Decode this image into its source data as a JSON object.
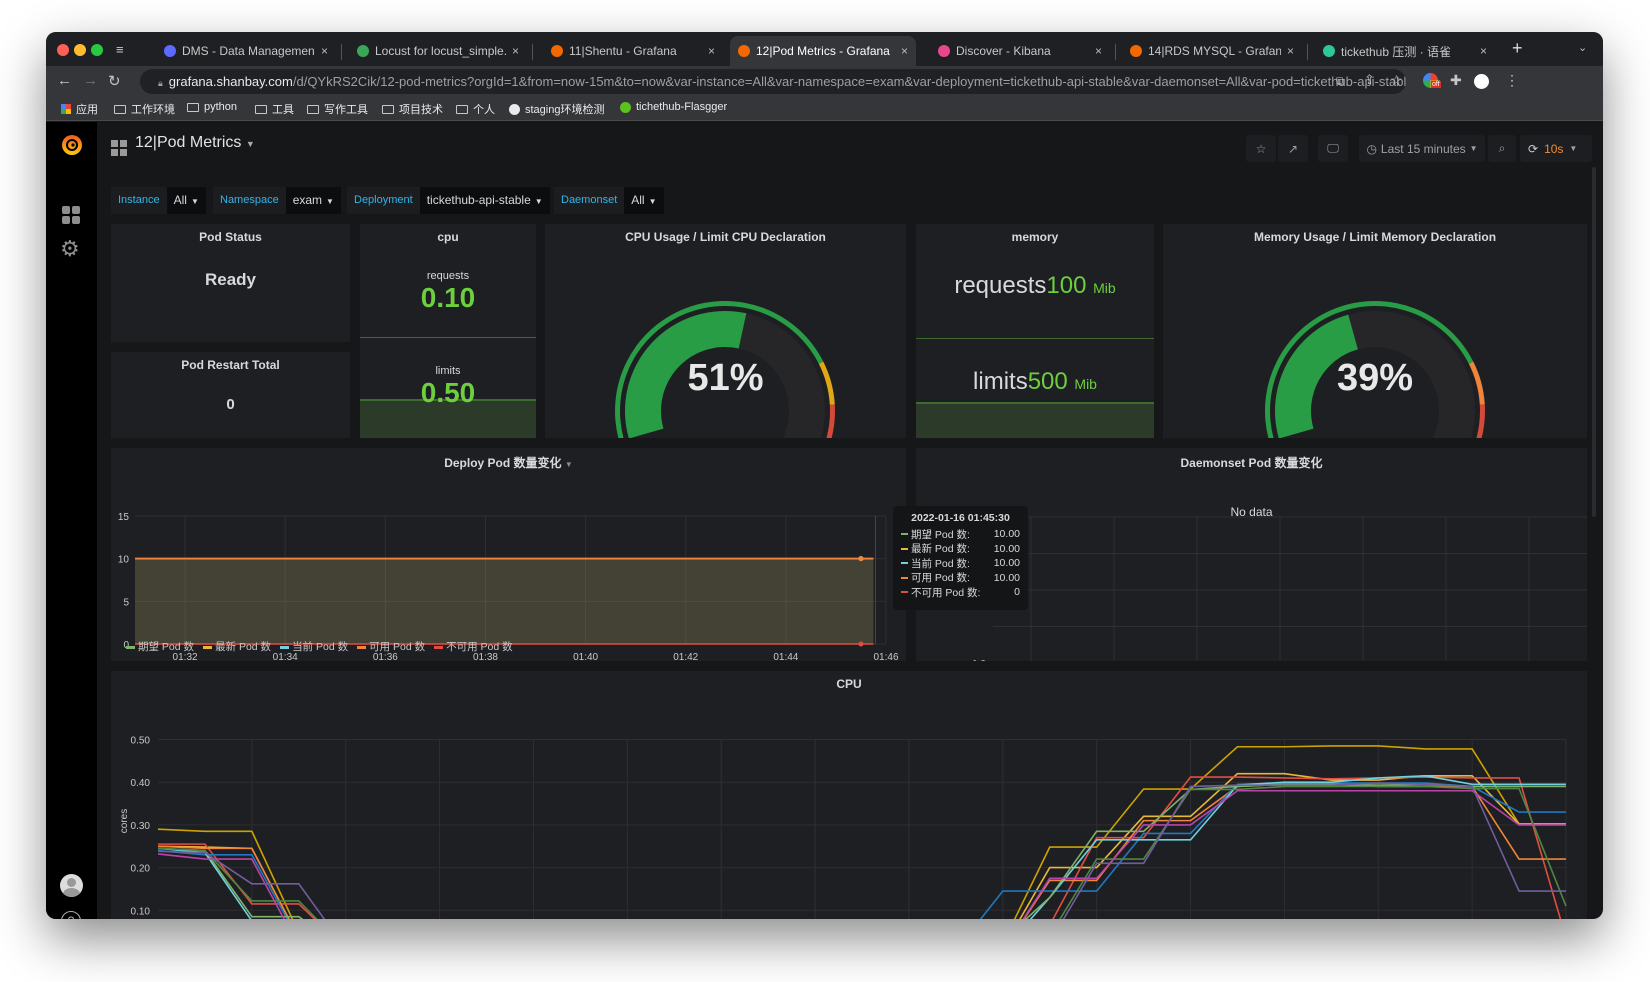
{
  "browser": {
    "tabs": [
      {
        "title": "DMS - Data Management Ser",
        "icon": "dms-icon",
        "color": "#5b6bff"
      },
      {
        "title": "Locust for locust_simple.py",
        "icon": "locust-icon",
        "color": "#3aa757"
      },
      {
        "title": "11|Shentu - Grafana",
        "icon": "grafana-icon",
        "color": "#f46800"
      },
      {
        "title": "12|Pod Metrics - Grafana",
        "icon": "grafana-icon",
        "color": "#f46800",
        "active": true
      },
      {
        "title": "Discover - Kibana",
        "icon": "kibana-icon",
        "color": "#e8488b"
      },
      {
        "title": "14|RDS MYSQL - Grafana",
        "icon": "grafana-icon",
        "color": "#f46800"
      },
      {
        "title": "tickethub 压测 · 语雀",
        "icon": "yuque-icon",
        "color": "#2fc795"
      }
    ],
    "url_host": "grafana.shanbay.com",
    "url_path": "/d/QYkRS2Cik/12-pod-metrics?orgId=1&from=now-15m&to=now&var-instance=All&var-namespace=exam&var-deployment=tickethub-api-stable&var-daemonset=All&var-pod=tickethub-api-stable-...",
    "extension_badge": "off",
    "bookmarks": [
      {
        "label": "应用",
        "icon": "apps-grid-icon"
      },
      {
        "label": "工作环境",
        "icon": "folder-icon"
      },
      {
        "label": "python",
        "icon": "folder-icon"
      },
      {
        "label": "工具",
        "icon": "folder-icon"
      },
      {
        "label": "写作工具",
        "icon": "folder-icon"
      },
      {
        "label": "项目技术",
        "icon": "folder-icon"
      },
      {
        "label": "个人",
        "icon": "folder-icon"
      },
      {
        "label": "staging环境检测",
        "icon": "globe-icon"
      },
      {
        "label": "tichethub-Flasgger",
        "icon": "flasgger-icon"
      }
    ]
  },
  "dashboard": {
    "title": "12|Pod Metrics",
    "time_range": "Last 15 minutes",
    "refresh": "10s",
    "variables": [
      {
        "label": "Instance",
        "value": "All"
      },
      {
        "label": "Namespace",
        "value": "exam"
      },
      {
        "label": "Deployment",
        "value": "tickethub-api-stable"
      },
      {
        "label": "Daemonset",
        "value": "All"
      }
    ]
  },
  "panels": {
    "pod_status": {
      "title": "Pod Status",
      "value": "Ready"
    },
    "pod_restart": {
      "title": "Pod Restart Total",
      "value": "0"
    },
    "cpu": {
      "title": "cpu",
      "requests_label": "requests",
      "requests": "0.10",
      "limits_label": "limits",
      "limits": "0.50"
    },
    "cpu_gauge": {
      "title": "CPU Usage / Limit CPU Declaration",
      "value_text": "51%",
      "percent": 51,
      "thresholds": [
        73,
        83
      ],
      "colors": [
        "#299c46",
        "#e0a816",
        "#d44a3a"
      ]
    },
    "memory": {
      "title": "memory",
      "requests_label": "requests",
      "requests": "100",
      "limits_label": "limits",
      "limits": "500",
      "unit": "Mib"
    },
    "memory_gauge": {
      "title": "Memory Usage / Limit Memory Declaration",
      "value_text": "39%",
      "percent": 39,
      "thresholds": [
        73,
        83
      ],
      "colors": [
        "#299c46",
        "#ef843c",
        "#d44a3a"
      ]
    },
    "deploy_title": "Deploy Pod 数量变化",
    "daemonset_title": "Daemonset Pod 数量变化",
    "daemonset_no_data": "No data",
    "cpu_title": "CPU",
    "tooltip": {
      "time": "2022-01-16 01:45:30",
      "rows": [
        {
          "name": "期望 Pod 数:",
          "value": "10.00",
          "color": "#7eb26d"
        },
        {
          "name": "最新 Pod 数:",
          "value": "10.00",
          "color": "#eab839"
        },
        {
          "name": "当前 Pod 数:",
          "value": "10.00",
          "color": "#6ed0e0"
        },
        {
          "name": "可用 Pod 数:",
          "value": "10.00",
          "color": "#ef843c"
        },
        {
          "name": "不可用 Pod 数:",
          "value": "0",
          "color": "#e24d42"
        }
      ]
    }
  },
  "chart_data": [
    {
      "type": "area",
      "title": "Deploy Pod 数量变化",
      "ylim": [
        0,
        15
      ],
      "yticks": [
        "0",
        "5",
        "10",
        "15"
      ],
      "xticks": [
        "01:32",
        "01:34",
        "01:36",
        "01:38",
        "01:40",
        "01:42",
        "01:44",
        "01:46"
      ],
      "x": [
        "01:31:00",
        "01:31:30",
        "01:32:00",
        "01:32:30",
        "01:33:00",
        "01:33:30",
        "01:34:00",
        "01:34:30",
        "01:35:00",
        "01:35:30",
        "01:36:00",
        "01:36:30",
        "01:37:00",
        "01:37:30",
        "01:38:00",
        "01:38:30",
        "01:39:00",
        "01:39:30",
        "01:40:00",
        "01:40:30",
        "01:41:00",
        "01:41:30",
        "01:42:00",
        "01:42:30",
        "01:43:00",
        "01:43:30",
        "01:44:00",
        "01:44:30",
        "01:45:00",
        "01:45:30"
      ],
      "legend": "bottom",
      "series": [
        {
          "name": "期望 Pod 数",
          "color": "#7eb26d",
          "values": [
            10,
            10,
            10,
            10,
            10,
            10,
            10,
            10,
            10,
            10,
            10,
            10,
            10,
            10,
            10,
            10,
            10,
            10,
            10,
            10,
            10,
            10,
            10,
            10,
            10,
            10,
            10,
            10,
            10,
            10
          ]
        },
        {
          "name": "最新 Pod 数",
          "color": "#eab839",
          "values": [
            10,
            10,
            10,
            10,
            10,
            10,
            10,
            10,
            10,
            10,
            10,
            10,
            10,
            10,
            10,
            10,
            10,
            10,
            10,
            10,
            10,
            10,
            10,
            10,
            10,
            10,
            10,
            10,
            10,
            10
          ]
        },
        {
          "name": "当前 Pod 数",
          "color": "#6ed0e0",
          "values": [
            10,
            10,
            10,
            10,
            10,
            10,
            10,
            10,
            10,
            10,
            10,
            10,
            10,
            10,
            10,
            10,
            10,
            10,
            10,
            10,
            10,
            10,
            10,
            10,
            10,
            10,
            10,
            10,
            10,
            10
          ]
        },
        {
          "name": "可用 Pod 数",
          "color": "#ef843c",
          "values": [
            10,
            10,
            10,
            10,
            10,
            10,
            10,
            10,
            10,
            10,
            10,
            10,
            10,
            10,
            10,
            10,
            10,
            10,
            10,
            10,
            10,
            10,
            10,
            10,
            10,
            10,
            10,
            10,
            10,
            10
          ]
        },
        {
          "name": "不可用 Pod 数",
          "color": "#e24d42",
          "values": [
            0,
            0,
            0,
            0,
            0,
            0,
            0,
            0,
            0,
            0,
            0,
            0,
            0,
            0,
            0,
            0,
            0,
            0,
            0,
            0,
            0,
            0,
            0,
            0,
            0,
            0,
            0,
            0,
            0,
            0
          ]
        }
      ]
    },
    {
      "type": "line",
      "title": "Daemonset Pod 数量变化",
      "ylim": [
        -1.0,
        1.0
      ],
      "yticks": [
        "-1.0",
        "1.0"
      ],
      "xticks": [
        "01:32",
        "01:34",
        "01:36",
        "01:38",
        "01:40",
        "01:42",
        "01:44",
        "01:46"
      ],
      "series": []
    },
    {
      "type": "line",
      "title": "CPU",
      "ylabel": "cores",
      "ylim": [
        0,
        0.5
      ],
      "yticks": [
        "0.10",
        "0.20",
        "0.30",
        "0.40",
        "0.50"
      ],
      "x": [
        "01:31:00",
        "01:31:30",
        "01:32:00",
        "01:32:30",
        "01:33:00",
        "01:33:30",
        "01:34:00",
        "01:34:30",
        "01:35:00",
        "01:35:30",
        "01:36:00",
        "01:36:30",
        "01:37:00",
        "01:37:30",
        "01:38:00",
        "01:38:30",
        "01:39:00",
        "01:39:30",
        "01:40:00",
        "01:40:30",
        "01:41:00",
        "01:41:30",
        "01:42:00",
        "01:42:30",
        "01:43:00",
        "01:43:30",
        "01:44:00",
        "01:44:30",
        "01:45:00",
        "01:45:30",
        "01:46:00"
      ],
      "series": [
        {
          "color": "#cca300",
          "values": [
            0.29,
            0.285,
            0.285,
            0.047,
            0.047,
            0.023,
            0.023,
            0.023,
            0.023,
            0.023,
            0.023,
            0.023,
            0.023,
            0.023,
            0.023,
            0.023,
            0.023,
            0.023,
            0.022,
            0.248,
            0.248,
            0.384,
            0.384,
            0.483,
            0.483,
            0.485,
            0.485,
            0.478,
            0.478,
            0.302,
            0.302
          ]
        },
        {
          "color": "#eab839",
          "values": [
            0.25,
            0.248,
            0.245,
            0.035,
            0.035,
            0.01,
            0.01,
            0.01,
            0.01,
            0.01,
            0.01,
            0.01,
            0.01,
            0.01,
            0.01,
            0.01,
            0.01,
            0.01,
            0.01,
            0.2,
            0.2,
            0.32,
            0.32,
            0.42,
            0.42,
            0.405,
            0.405,
            0.415,
            0.415,
            0.302,
            0.302
          ]
        },
        {
          "color": "#e24d42",
          "values": [
            0.255,
            0.255,
            0.115,
            0.115,
            0.01,
            0.008,
            0.008,
            0.008,
            0.008,
            0.008,
            0.008,
            0.008,
            0.008,
            0.008,
            0.008,
            0.008,
            0.008,
            0.008,
            0.065,
            0.065,
            0.27,
            0.27,
            0.412,
            0.412,
            0.41,
            0.408,
            0.41,
            0.412,
            0.41,
            0.41,
            0.035
          ]
        },
        {
          "color": "#ef843c",
          "values": [
            0.25,
            0.245,
            0.245,
            0.035,
            0.035,
            0.008,
            0.008,
            0.008,
            0.008,
            0.008,
            0.008,
            0.008,
            0.008,
            0.008,
            0.008,
            0.008,
            0.008,
            0.008,
            0.005,
            0.17,
            0.17,
            0.31,
            0.31,
            0.39,
            0.395,
            0.395,
            0.39,
            0.39,
            0.39,
            0.22,
            0.22
          ]
        },
        {
          "color": "#1f78c1",
          "values": [
            0.24,
            0.23,
            0.23,
            0.03,
            0.005,
            0.006,
            0.006,
            0.006,
            0.006,
            0.006,
            0.006,
            0.006,
            0.006,
            0.006,
            0.006,
            0.006,
            0.006,
            0.006,
            0.145,
            0.145,
            0.145,
            0.28,
            0.28,
            0.395,
            0.398,
            0.398,
            0.398,
            0.398,
            0.39,
            0.33,
            0.33
          ]
        },
        {
          "color": "#6ed0e0",
          "values": [
            0.245,
            0.235,
            0.075,
            0.075,
            0.005,
            0.005,
            0.005,
            0.005,
            0.005,
            0.005,
            0.005,
            0.005,
            0.005,
            0.005,
            0.005,
            0.005,
            0.005,
            0.005,
            0.005,
            0.13,
            0.265,
            0.265,
            0.265,
            0.393,
            0.4,
            0.4,
            0.41,
            0.415,
            0.395,
            0.395,
            0.395
          ]
        },
        {
          "color": "#7eb26d",
          "values": [
            0.245,
            0.24,
            0.085,
            0.085,
            0.005,
            0.005,
            0.005,
            0.005,
            0.005,
            0.005,
            0.005,
            0.005,
            0.005,
            0.005,
            0.005,
            0.005,
            0.005,
            0.005,
            0.03,
            0.13,
            0.285,
            0.285,
            0.383,
            0.39,
            0.395,
            0.395,
            0.393,
            0.395,
            0.39,
            0.39,
            0.39
          ]
        },
        {
          "color": "#508642",
          "values": [
            0.245,
            0.24,
            0.122,
            0.122,
            0.01,
            0.01,
            0.01,
            0.01,
            0.01,
            0.01,
            0.01,
            0.01,
            0.01,
            0.01,
            0.01,
            0.01,
            0.01,
            0.01,
            0.04,
            0.04,
            0.22,
            0.22,
            0.383,
            0.383,
            0.39,
            0.39,
            0.39,
            0.39,
            0.385,
            0.385,
            0.11
          ]
        },
        {
          "color": "#ba43a9",
          "values": [
            0.232,
            0.22,
            0.22,
            0.015,
            0.015,
            0.005,
            0.005,
            0.005,
            0.005,
            0.005,
            0.005,
            0.005,
            0.005,
            0.005,
            0.005,
            0.005,
            0.005,
            0.005,
            0.005,
            0.175,
            0.175,
            0.3,
            0.3,
            0.38,
            0.38,
            0.38,
            0.38,
            0.38,
            0.38,
            0.3,
            0.3
          ]
        },
        {
          "color": "#705da0",
          "values": [
            0.238,
            0.235,
            0.162,
            0.162,
            0.01,
            0.008,
            0.008,
            0.008,
            0.008,
            0.008,
            0.008,
            0.008,
            0.008,
            0.008,
            0.008,
            0.008,
            0.008,
            0.008,
            0.025,
            0.025,
            0.21,
            0.21,
            0.39,
            0.393,
            0.393,
            0.393,
            0.398,
            0.395,
            0.39,
            0.145,
            0.145
          ]
        }
      ]
    }
  ]
}
